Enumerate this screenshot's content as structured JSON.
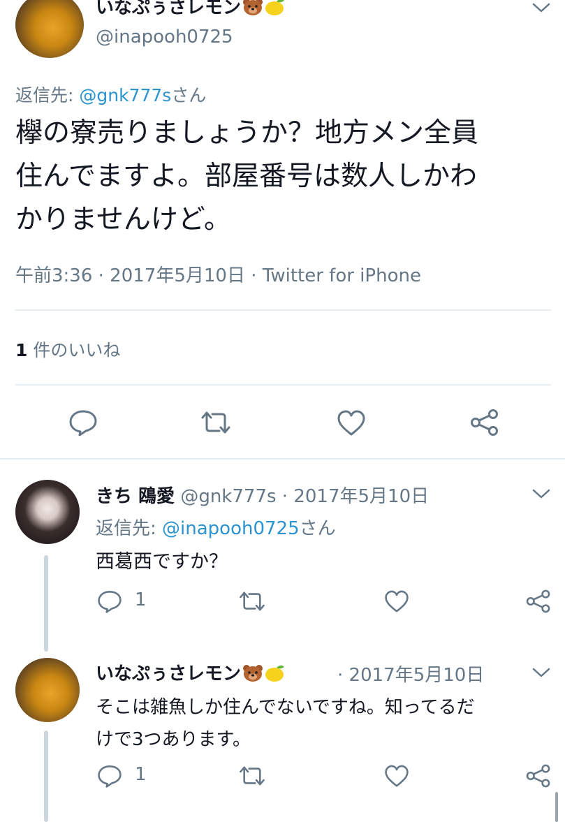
{
  "main_tweet": {
    "display_name": "いなぷぅさレモン",
    "handle": "@inapooh0725",
    "reply_prefix": "返信先: ",
    "reply_to": "@gnk777s",
    "reply_suffix": "さん",
    "text_line1": "欅の寮売りましょうか？地方メン全員",
    "text_line2": "住んでますよ。部屋番号は数人しかわ",
    "text_line3": "かりませんけど。",
    "meta": "午前3:36 · 2017年5月10日 · Twitter for iPhone",
    "likes_count": "1",
    "likes_label": " 件のいいね"
  },
  "reply1": {
    "display_name": "きち 鴎愛",
    "handle": "@gnk777s",
    "date": " · 2017年5月10日",
    "reply_prefix": "返信先: ",
    "reply_to": "@inapooh0725",
    "reply_suffix": "さん",
    "text": "西葛西ですか？",
    "reply_count": "1"
  },
  "reply2": {
    "display_name": "いなぷぅさレモン",
    "date": "· 2017年5月10日",
    "text_line1": "そこは雑魚しか住んでないですね。知ってるだ",
    "text_line2": "けで3つあります。",
    "reply_count": "1"
  },
  "icons": [
    "chevron-down-icon",
    "reply-icon",
    "retweet-icon",
    "like-icon",
    "share-icon",
    "bear-emoji",
    "lemon-emoji"
  ],
  "colors": {
    "link": "#2b93cf",
    "secondary": "#657786",
    "icon": "#657786",
    "divider": "#e6ecf0",
    "thread_line": "#ccd6dd"
  }
}
